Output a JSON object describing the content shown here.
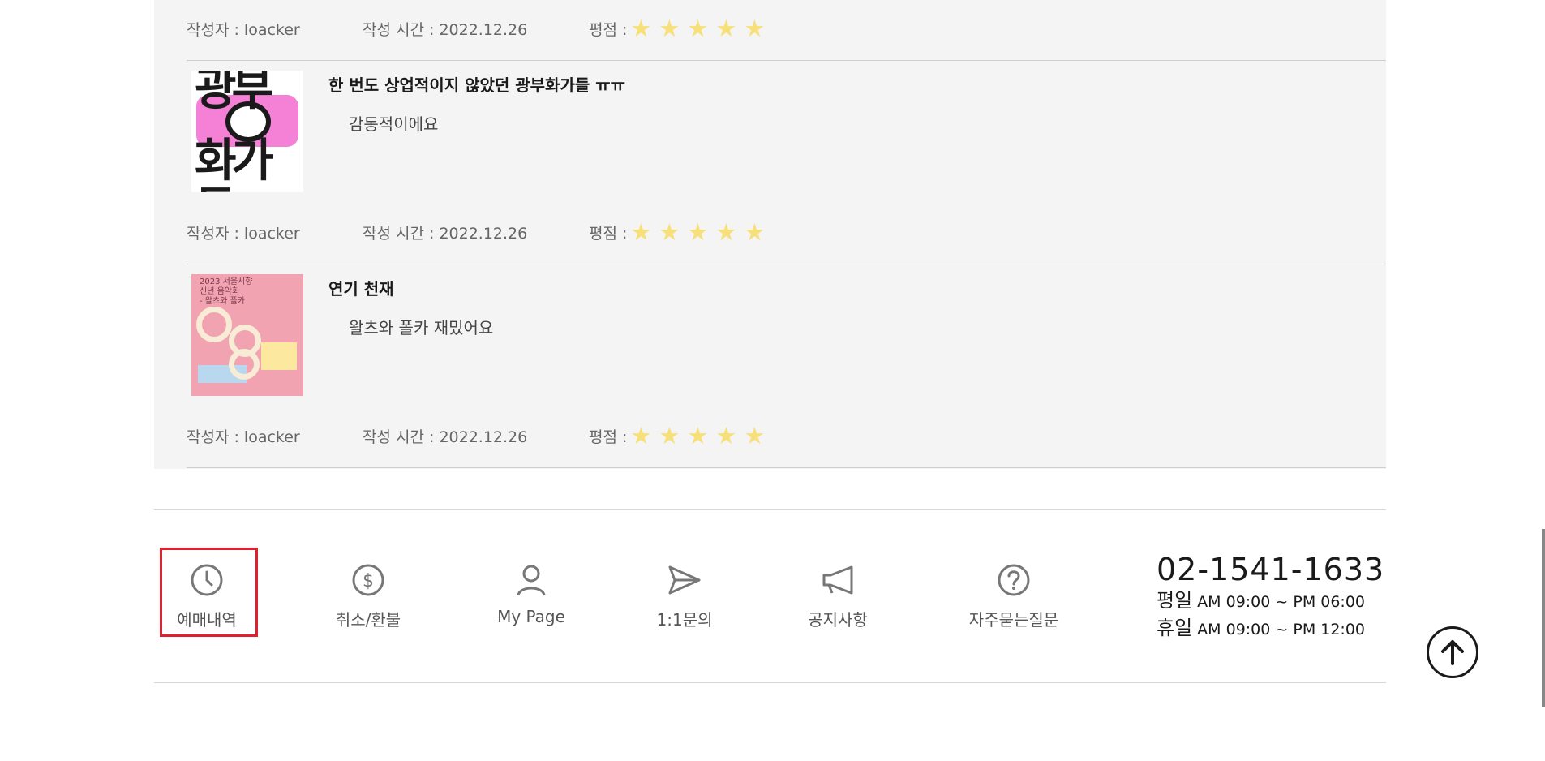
{
  "reviews": [
    {
      "author": "작성자 : loacker",
      "time": "작성 시간 : 2022.12.26",
      "rating_label": "평점 :",
      "stars": 5
    },
    {
      "title": "한 번도 상업적이지 않았던 광부화가들 ㅠㅠ",
      "body": "감동적이에요",
      "author": "작성자 : loacker",
      "time": "작성 시간 : 2022.12.26",
      "rating_label": "평점 :",
      "stars": 5,
      "poster_text": "광부화가들"
    },
    {
      "title": "연기 천재",
      "body": "왈츠와 폴카 재밌어요",
      "author": "작성자 : loacker",
      "time": "작성 시간 : 2022.12.26",
      "rating_label": "평점 :",
      "stars": 5
    }
  ],
  "footer": {
    "nav": [
      {
        "label": "예매내역",
        "icon": "clock-icon"
      },
      {
        "label": "취소/환불",
        "icon": "dollar-icon"
      },
      {
        "label": "My Page",
        "icon": "user-icon"
      },
      {
        "label": "1:1문의",
        "icon": "send-icon"
      },
      {
        "label": "공지사항",
        "icon": "megaphone-icon"
      },
      {
        "label": "자주묻는질문",
        "icon": "question-icon"
      }
    ],
    "phone": "02-1541-1633",
    "weekday_label": "평일",
    "weekday_hours": "AM 09:00 ~ PM 06:00",
    "holiday_label": "휴일",
    "holiday_hours": "AM 09:00 ~ PM 12:00"
  },
  "colors": {
    "star": "#f7e07a",
    "highlight": "#e0202c",
    "panel": "#f4f4f4"
  },
  "star_glyph": "★"
}
